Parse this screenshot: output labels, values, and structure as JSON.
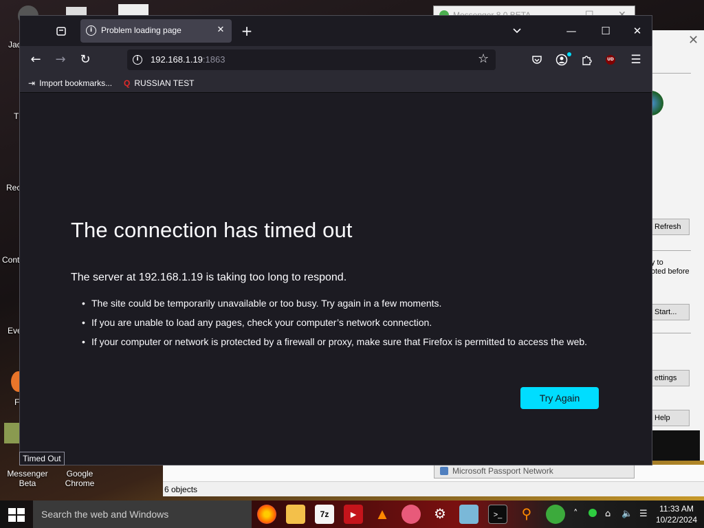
{
  "desktop": {
    "icons_left": [
      "Jac",
      "T",
      "Rec",
      "Cont",
      "Eve",
      "F"
    ],
    "messenger": "Messenger Beta",
    "chrome": "Google Chrome"
  },
  "bg_window": {
    "title": "Messenger 8.0 BETA"
  },
  "bg_dialog": {
    "refresh": "Refresh",
    "text1": "y to",
    "text2": "oted before",
    "start": "Start...",
    "settings": "ettings",
    "help": "Help"
  },
  "bg_passport": "Microsoft Passport Network",
  "bg_status": "6 objects",
  "browser": {
    "tab_title": "Problem loading page",
    "url_host": "192.168.1.19",
    "url_port": ":1863",
    "bookmarks": [
      {
        "label": "Import bookmarks...",
        "icon": "import-icon"
      },
      {
        "label": "RUSSIAN TEST",
        "icon": "bookmark-favicon"
      }
    ],
    "error": {
      "title": "The connection has timed out",
      "description": "The server at 192.168.1.19 is taking too long to respond.",
      "items": [
        "The site could be temporarily unavailable or too busy. Try again in a few moments.",
        "If you are unable to load any pages, check your computer’s network connection.",
        "If your computer or network is protected by a firewall or proxy, make sure that Firefox is permitted to access the web."
      ],
      "button": "Try Again"
    },
    "tooltip": "Timed Out",
    "extension_badge": "UD",
    "accent": "#00ddff"
  },
  "taskbar": {
    "search_placeholder": "Search the web and Windows",
    "time": "11:33 AM",
    "date": "10/22/2024",
    "apps": [
      "firefox",
      "file-explorer",
      "7z",
      "media-app",
      "vlc",
      "app",
      "settings",
      "app",
      "terminal",
      "search-app",
      "messenger"
    ]
  }
}
